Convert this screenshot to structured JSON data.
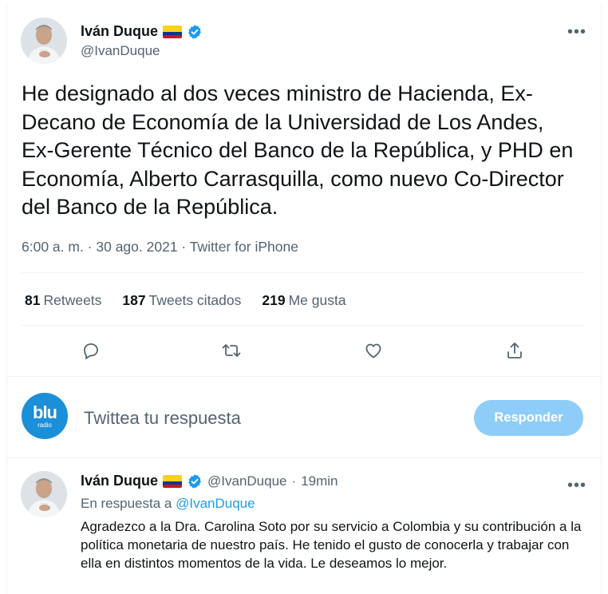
{
  "main_tweet": {
    "author_name": "Iván Duque",
    "author_handle": "@IvanDuque",
    "more_label": "•••",
    "text": "He designado al dos veces ministro de Hacienda, Ex-Decano de Economía de la Universidad de Los Andes, Ex-Gerente Técnico del Banco de la República, y PHD en Economía, Alberto Carrasquilla, como nuevo Co-Director del Banco de la República.",
    "meta": "6:00 a. m. · 30 ago. 2021 · Twitter for iPhone",
    "stats": [
      {
        "count": "81",
        "label": "Retweets"
      },
      {
        "count": "187",
        "label": "Tweets citados"
      },
      {
        "count": "219",
        "label": "Me gusta"
      }
    ],
    "action_icons": [
      "reply-icon",
      "retweet-icon",
      "like-icon",
      "share-icon"
    ]
  },
  "reply_composer": {
    "avatar_text": "blu",
    "avatar_subtext": "radio",
    "placeholder": "Twittea tu respuesta",
    "button_label": "Responder",
    "button_color": "#8ecdf8"
  },
  "reply_tweet": {
    "author_name": "Iván Duque",
    "author_handle": "@IvanDuque",
    "separator": "·",
    "time": "19min",
    "more_label": "•••",
    "in_reply_prefix": "En respuesta a",
    "in_reply_handle": "@IvanDuque",
    "text": "Agradezco a la Dra. Carolina Soto por su servicio a Colombia y su contribución a la política monetaria de nuestro país. He tenido el gusto de conocerla y trabajar con ella en distintos momentos de la vida. Le deseamos lo mejor."
  },
  "colors": {
    "text_primary": "#0f1419",
    "text_secondary": "#536471",
    "accent": "#1d9bf0",
    "divider": "#eff3f4"
  }
}
